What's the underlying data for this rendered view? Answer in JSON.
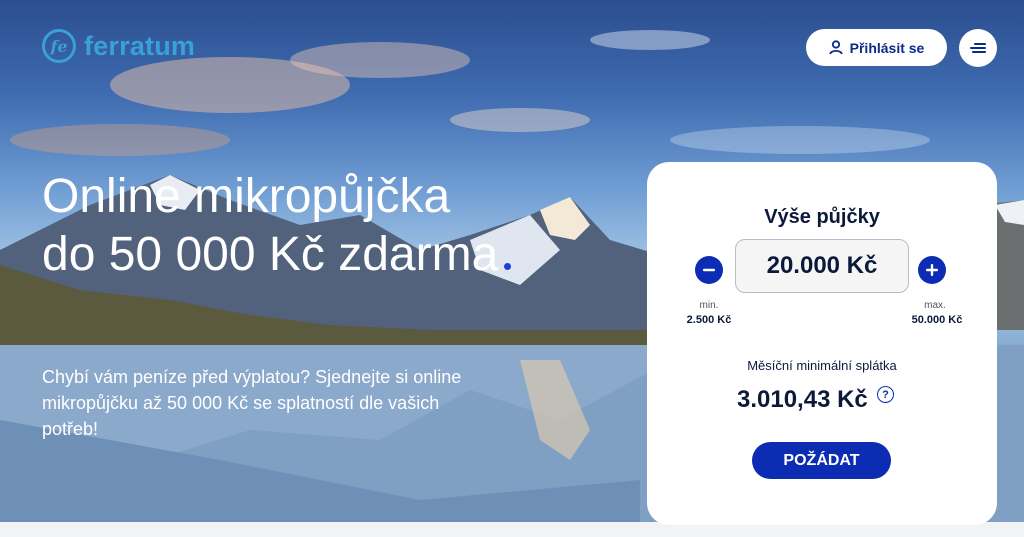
{
  "brand": {
    "logo_mark": "fe",
    "name": "ferratum",
    "color": "#3aa0d8"
  },
  "header": {
    "login_label": "Přihlásit se",
    "login_icon": "user-icon",
    "menu_icon": "menu-icon"
  },
  "hero": {
    "headline": "Online mikropůjčka do 50 000 Kč zdarma",
    "subtext": "Chybí vám peníze před výplatou? Sjednejte si online mikropůjčku až 50 000 Kč se splatností dle vašich potřeb!"
  },
  "calculator": {
    "title": "Výše půjčky",
    "amount": "20.000 Kč",
    "min_label": "min.",
    "min_value": "2.500 Kč",
    "max_label": "max.",
    "max_value": "50.000 Kč",
    "monthly_label": "Měsíční minimální splátka",
    "monthly_value": "3.010,43 Kč",
    "help_symbol": "?",
    "cta_label": "POŽÁDAT",
    "accent": "#0b2cb3"
  }
}
